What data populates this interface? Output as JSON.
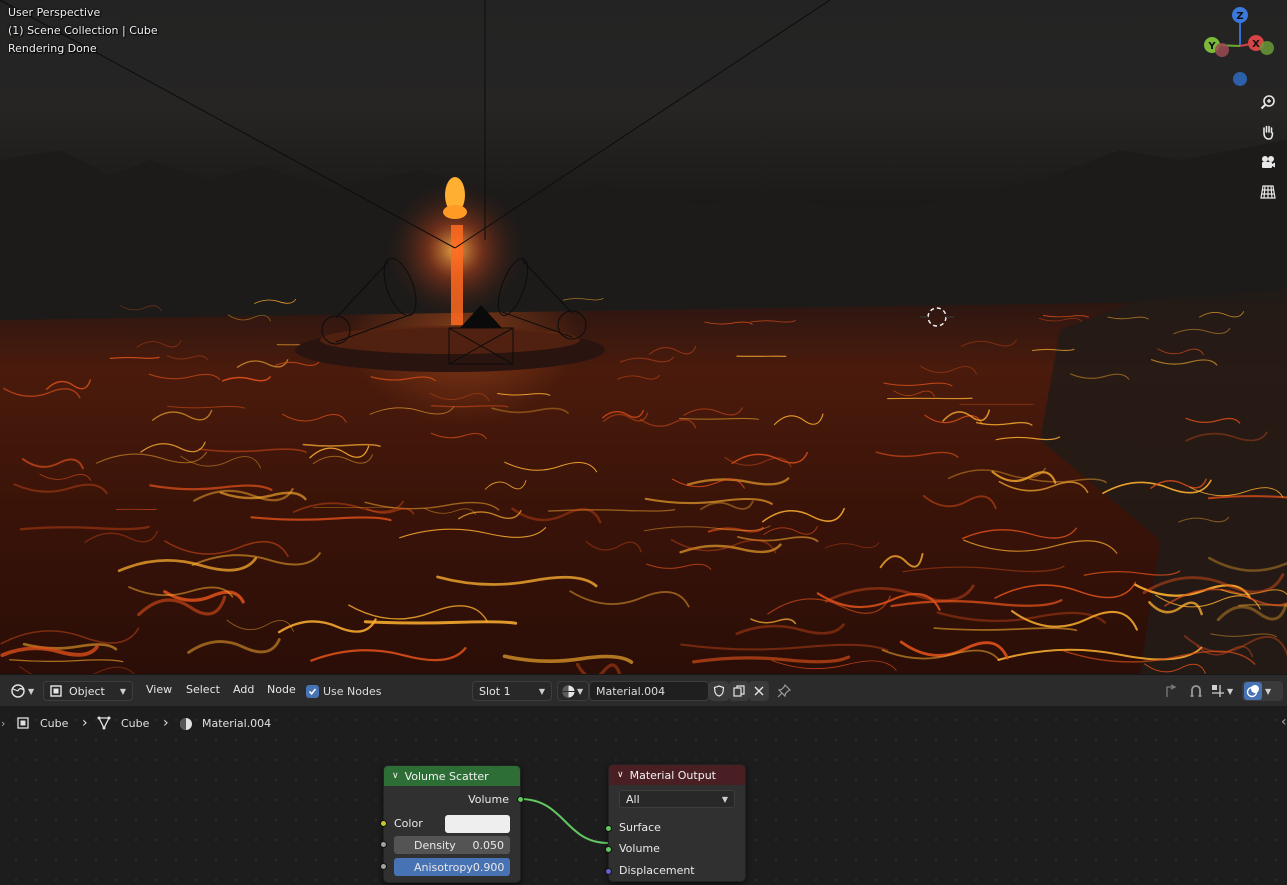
{
  "viewport": {
    "info_lines": [
      "User Perspective",
      "(1) Scene Collection | Cube",
      "Rendering Done"
    ],
    "gizmo": {
      "z": "Z",
      "y": "Y",
      "x": "X"
    },
    "nav_icons": [
      "zoom-icon",
      "hand-pan-icon",
      "camera-icon",
      "ortho-grid-icon"
    ],
    "colors": {
      "lava_hot": "#ffb030",
      "lava_mid": "#e0501a",
      "lava_dark": "#3a1208",
      "fog": "#262626"
    }
  },
  "node_header": {
    "editor_type_icon": "node-editor-icon",
    "object_mode": "Object",
    "menus": [
      "View",
      "Select",
      "Add",
      "Node"
    ],
    "use_nodes_label": "Use Nodes",
    "use_nodes_checked": true,
    "slot": "Slot 1",
    "material_name": "Material.004"
  },
  "breadcrumb": [
    "Cube",
    "Cube",
    "Material.004"
  ],
  "nodes": {
    "volume_scatter": {
      "title": "Volume Scatter",
      "output": "Volume",
      "color_label": "Color",
      "color_value": "#eeeeee",
      "density_label": "Density",
      "density_value": "0.050",
      "anisotropy_label": "Anisotropy",
      "anisotropy_value": "0.900"
    },
    "material_output": {
      "title": "Material Output",
      "target": "All",
      "inputs": [
        "Surface",
        "Volume",
        "Displacement"
      ]
    }
  },
  "colors": {
    "node_green_header": "#2c6e35",
    "node_red_header": "#4a1f24",
    "socket_yellow": "#c7c729",
    "socket_green": "#63c763",
    "socket_gray": "#a1a1a1",
    "socket_purple": "#6363c7",
    "active_field": "#4772b3",
    "link_green": "#63c763"
  }
}
